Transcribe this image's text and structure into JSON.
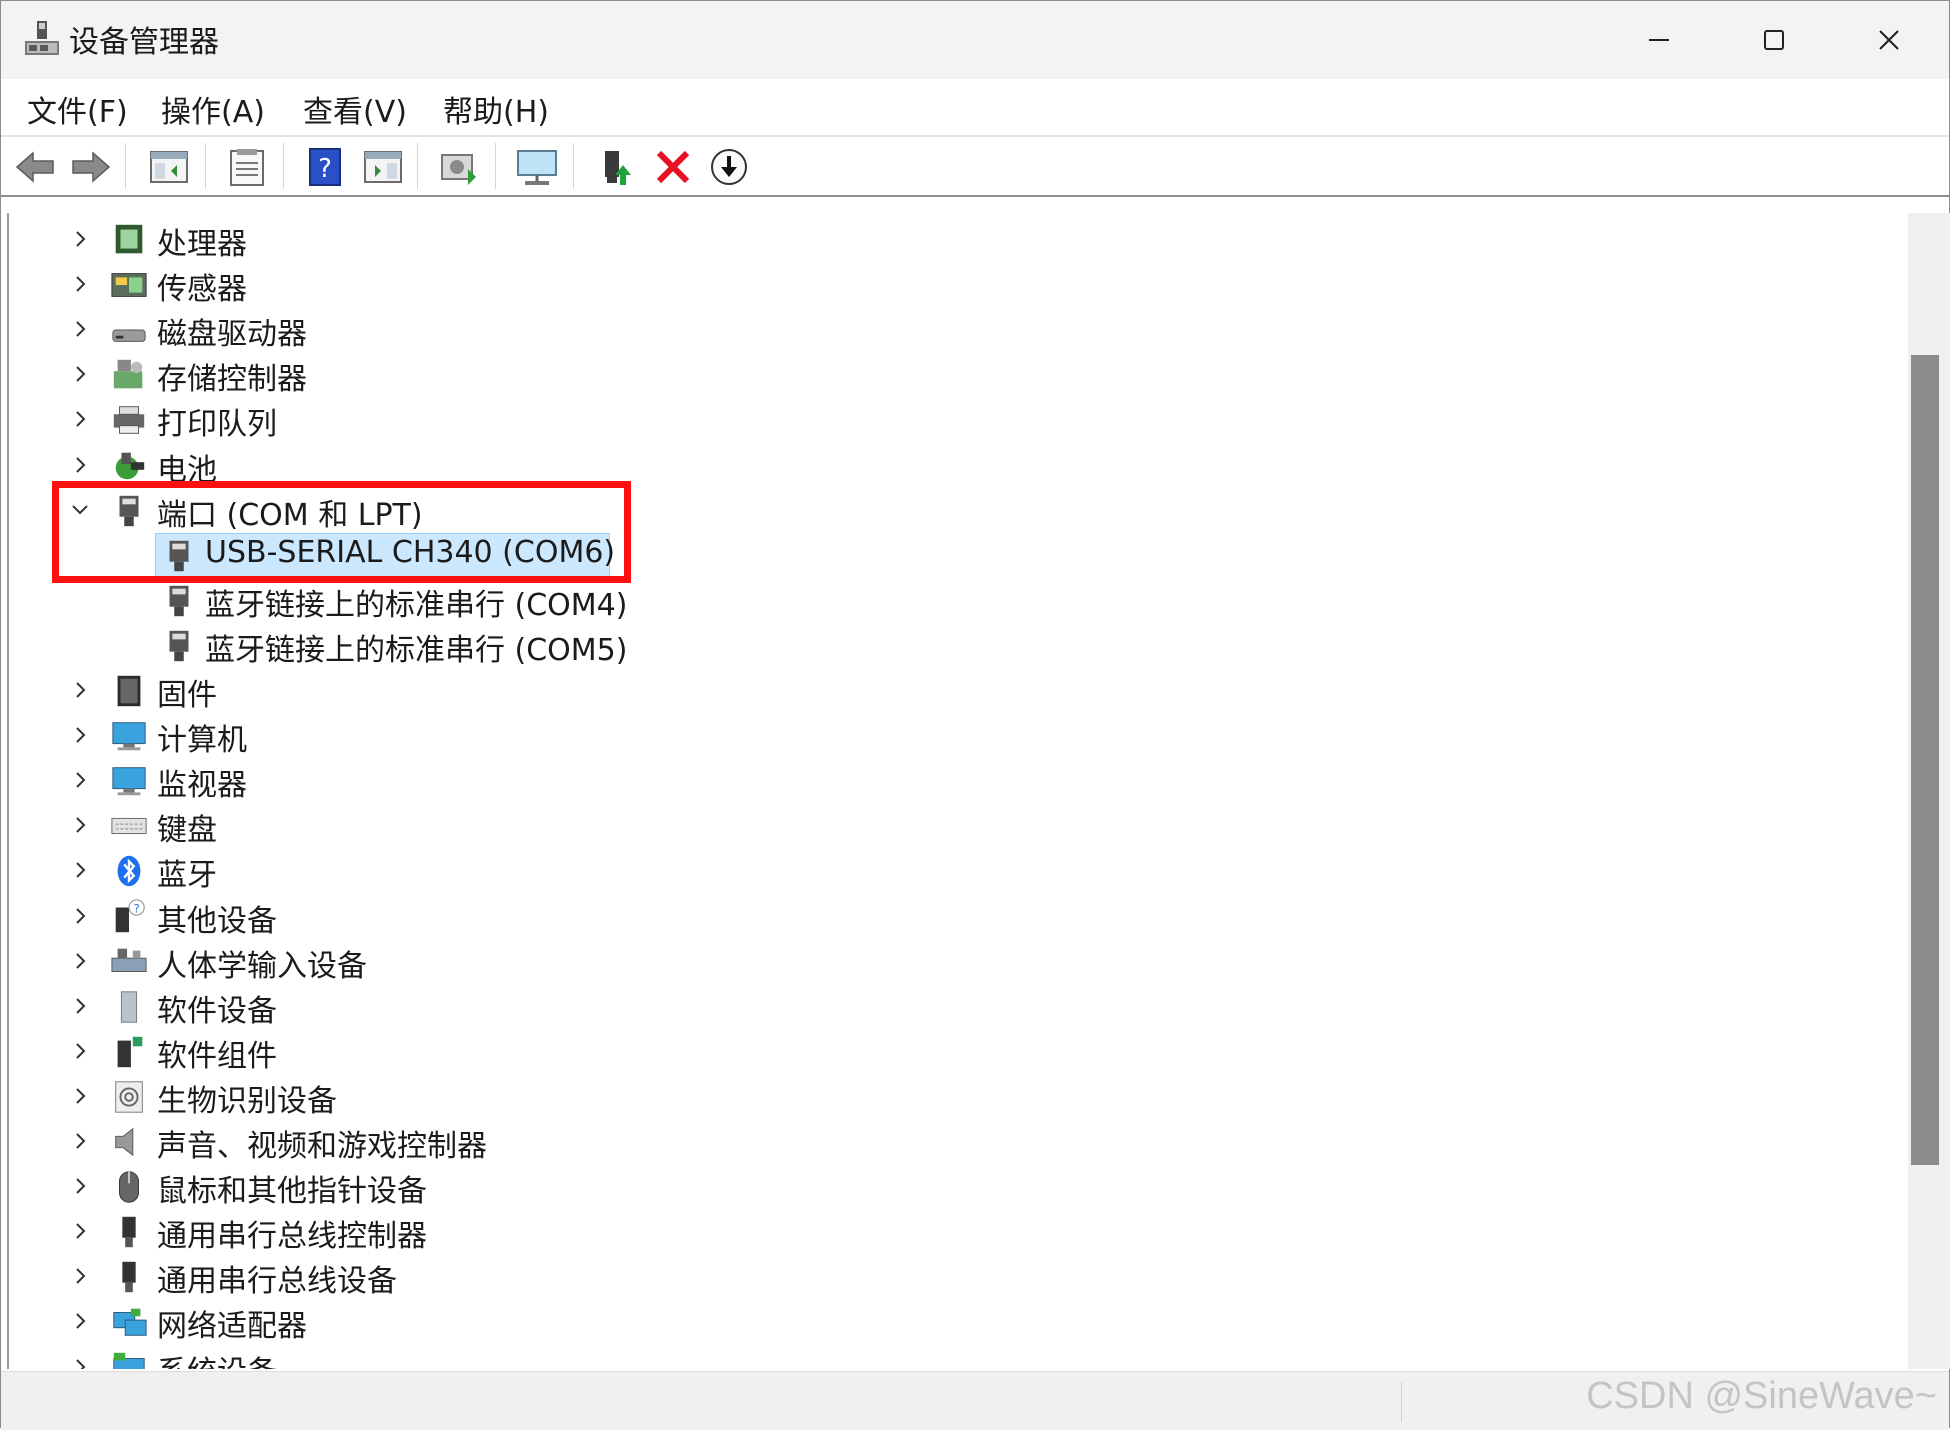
{
  "window": {
    "title": "设备管理器",
    "minimize": "minimize",
    "maximize": "maximize",
    "close": "close"
  },
  "menu": [
    "文件(F)",
    "操作(A)",
    "查看(V)",
    "帮助(H)"
  ],
  "toolbar": {
    "icons": [
      "back-icon",
      "forward-icon",
      "show-hide-console-tree-icon",
      "properties-icon",
      "help-icon",
      "action-pane-icon",
      "scan-hardware-icon",
      "computer-monitor-icon",
      "update-driver-icon",
      "uninstall-icon",
      "download-icon"
    ]
  },
  "tree": {
    "categories_top": [
      {
        "label": "处理器",
        "icon": "cpu-icon"
      },
      {
        "label": "传感器",
        "icon": "sensor-icon"
      },
      {
        "label": "磁盘驱动器",
        "icon": "disk-drive-icon"
      },
      {
        "label": "存储控制器",
        "icon": "storage-controller-icon"
      },
      {
        "label": "打印队列",
        "icon": "printer-icon"
      },
      {
        "label": "电池",
        "icon": "battery-icon"
      }
    ],
    "ports": {
      "label": "端口 (COM 和 LPT)",
      "icon": "port-icon",
      "children": [
        {
          "label": "USB-SERIAL CH340 (COM6)",
          "selected": true
        },
        {
          "label": "蓝牙链接上的标准串行 (COM4)",
          "selected": false
        },
        {
          "label": "蓝牙链接上的标准串行 (COM5)",
          "selected": false
        }
      ]
    },
    "categories_bottom": [
      {
        "label": "固件",
        "icon": "firmware-icon"
      },
      {
        "label": "计算机",
        "icon": "computer-icon"
      },
      {
        "label": "监视器",
        "icon": "monitor-icon"
      },
      {
        "label": "键盘",
        "icon": "keyboard-icon"
      },
      {
        "label": "蓝牙",
        "icon": "bluetooth-icon"
      },
      {
        "label": "其他设备",
        "icon": "other-devices-icon"
      },
      {
        "label": "人体学输入设备",
        "icon": "hid-icon"
      },
      {
        "label": "软件设备",
        "icon": "software-device-icon"
      },
      {
        "label": "软件组件",
        "icon": "software-component-icon"
      },
      {
        "label": "生物识别设备",
        "icon": "biometric-icon"
      },
      {
        "label": "声音、视频和游戏控制器",
        "icon": "audio-icon"
      },
      {
        "label": "鼠标和其他指针设备",
        "icon": "mouse-icon"
      },
      {
        "label": "通用串行总线控制器",
        "icon": "usb-controller-icon"
      },
      {
        "label": "通用串行总线设备",
        "icon": "usb-device-icon"
      },
      {
        "label": "网络适配器",
        "icon": "network-adapter-icon"
      },
      {
        "label": "系统设备",
        "icon": "system-devices-icon"
      }
    ]
  },
  "colors": {
    "selection_bg": "#cce8ff",
    "highlight_box": "#ff1010",
    "uninstall_red": "#e81123"
  },
  "watermark": "CSDN @SineWave~"
}
